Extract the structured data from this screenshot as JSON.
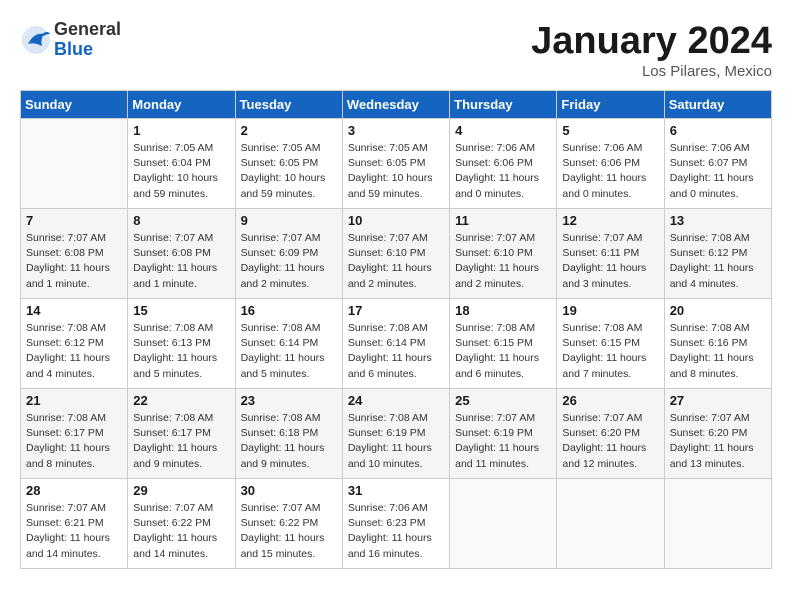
{
  "header": {
    "logo_general": "General",
    "logo_blue": "Blue",
    "month_title": "January 2024",
    "location": "Los Pilares, Mexico"
  },
  "days_of_week": [
    "Sunday",
    "Monday",
    "Tuesday",
    "Wednesday",
    "Thursday",
    "Friday",
    "Saturday"
  ],
  "weeks": [
    [
      {
        "num": "",
        "sunrise": "",
        "sunset": "",
        "daylight": ""
      },
      {
        "num": "1",
        "sunrise": "Sunrise: 7:05 AM",
        "sunset": "Sunset: 6:04 PM",
        "daylight": "Daylight: 10 hours and 59 minutes."
      },
      {
        "num": "2",
        "sunrise": "Sunrise: 7:05 AM",
        "sunset": "Sunset: 6:05 PM",
        "daylight": "Daylight: 10 hours and 59 minutes."
      },
      {
        "num": "3",
        "sunrise": "Sunrise: 7:05 AM",
        "sunset": "Sunset: 6:05 PM",
        "daylight": "Daylight: 10 hours and 59 minutes."
      },
      {
        "num": "4",
        "sunrise": "Sunrise: 7:06 AM",
        "sunset": "Sunset: 6:06 PM",
        "daylight": "Daylight: 11 hours and 0 minutes."
      },
      {
        "num": "5",
        "sunrise": "Sunrise: 7:06 AM",
        "sunset": "Sunset: 6:06 PM",
        "daylight": "Daylight: 11 hours and 0 minutes."
      },
      {
        "num": "6",
        "sunrise": "Sunrise: 7:06 AM",
        "sunset": "Sunset: 6:07 PM",
        "daylight": "Daylight: 11 hours and 0 minutes."
      }
    ],
    [
      {
        "num": "7",
        "sunrise": "Sunrise: 7:07 AM",
        "sunset": "Sunset: 6:08 PM",
        "daylight": "Daylight: 11 hours and 1 minute."
      },
      {
        "num": "8",
        "sunrise": "Sunrise: 7:07 AM",
        "sunset": "Sunset: 6:08 PM",
        "daylight": "Daylight: 11 hours and 1 minute."
      },
      {
        "num": "9",
        "sunrise": "Sunrise: 7:07 AM",
        "sunset": "Sunset: 6:09 PM",
        "daylight": "Daylight: 11 hours and 2 minutes."
      },
      {
        "num": "10",
        "sunrise": "Sunrise: 7:07 AM",
        "sunset": "Sunset: 6:10 PM",
        "daylight": "Daylight: 11 hours and 2 minutes."
      },
      {
        "num": "11",
        "sunrise": "Sunrise: 7:07 AM",
        "sunset": "Sunset: 6:10 PM",
        "daylight": "Daylight: 11 hours and 2 minutes."
      },
      {
        "num": "12",
        "sunrise": "Sunrise: 7:07 AM",
        "sunset": "Sunset: 6:11 PM",
        "daylight": "Daylight: 11 hours and 3 minutes."
      },
      {
        "num": "13",
        "sunrise": "Sunrise: 7:08 AM",
        "sunset": "Sunset: 6:12 PM",
        "daylight": "Daylight: 11 hours and 4 minutes."
      }
    ],
    [
      {
        "num": "14",
        "sunrise": "Sunrise: 7:08 AM",
        "sunset": "Sunset: 6:12 PM",
        "daylight": "Daylight: 11 hours and 4 minutes."
      },
      {
        "num": "15",
        "sunrise": "Sunrise: 7:08 AM",
        "sunset": "Sunset: 6:13 PM",
        "daylight": "Daylight: 11 hours and 5 minutes."
      },
      {
        "num": "16",
        "sunrise": "Sunrise: 7:08 AM",
        "sunset": "Sunset: 6:14 PM",
        "daylight": "Daylight: 11 hours and 5 minutes."
      },
      {
        "num": "17",
        "sunrise": "Sunrise: 7:08 AM",
        "sunset": "Sunset: 6:14 PM",
        "daylight": "Daylight: 11 hours and 6 minutes."
      },
      {
        "num": "18",
        "sunrise": "Sunrise: 7:08 AM",
        "sunset": "Sunset: 6:15 PM",
        "daylight": "Daylight: 11 hours and 6 minutes."
      },
      {
        "num": "19",
        "sunrise": "Sunrise: 7:08 AM",
        "sunset": "Sunset: 6:15 PM",
        "daylight": "Daylight: 11 hours and 7 minutes."
      },
      {
        "num": "20",
        "sunrise": "Sunrise: 7:08 AM",
        "sunset": "Sunset: 6:16 PM",
        "daylight": "Daylight: 11 hours and 8 minutes."
      }
    ],
    [
      {
        "num": "21",
        "sunrise": "Sunrise: 7:08 AM",
        "sunset": "Sunset: 6:17 PM",
        "daylight": "Daylight: 11 hours and 8 minutes."
      },
      {
        "num": "22",
        "sunrise": "Sunrise: 7:08 AM",
        "sunset": "Sunset: 6:17 PM",
        "daylight": "Daylight: 11 hours and 9 minutes."
      },
      {
        "num": "23",
        "sunrise": "Sunrise: 7:08 AM",
        "sunset": "Sunset: 6:18 PM",
        "daylight": "Daylight: 11 hours and 9 minutes."
      },
      {
        "num": "24",
        "sunrise": "Sunrise: 7:08 AM",
        "sunset": "Sunset: 6:19 PM",
        "daylight": "Daylight: 11 hours and 10 minutes."
      },
      {
        "num": "25",
        "sunrise": "Sunrise: 7:07 AM",
        "sunset": "Sunset: 6:19 PM",
        "daylight": "Daylight: 11 hours and 11 minutes."
      },
      {
        "num": "26",
        "sunrise": "Sunrise: 7:07 AM",
        "sunset": "Sunset: 6:20 PM",
        "daylight": "Daylight: 11 hours and 12 minutes."
      },
      {
        "num": "27",
        "sunrise": "Sunrise: 7:07 AM",
        "sunset": "Sunset: 6:20 PM",
        "daylight": "Daylight: 11 hours and 13 minutes."
      }
    ],
    [
      {
        "num": "28",
        "sunrise": "Sunrise: 7:07 AM",
        "sunset": "Sunset: 6:21 PM",
        "daylight": "Daylight: 11 hours and 14 minutes."
      },
      {
        "num": "29",
        "sunrise": "Sunrise: 7:07 AM",
        "sunset": "Sunset: 6:22 PM",
        "daylight": "Daylight: 11 hours and 14 minutes."
      },
      {
        "num": "30",
        "sunrise": "Sunrise: 7:07 AM",
        "sunset": "Sunset: 6:22 PM",
        "daylight": "Daylight: 11 hours and 15 minutes."
      },
      {
        "num": "31",
        "sunrise": "Sunrise: 7:06 AM",
        "sunset": "Sunset: 6:23 PM",
        "daylight": "Daylight: 11 hours and 16 minutes."
      },
      {
        "num": "",
        "sunrise": "",
        "sunset": "",
        "daylight": ""
      },
      {
        "num": "",
        "sunrise": "",
        "sunset": "",
        "daylight": ""
      },
      {
        "num": "",
        "sunrise": "",
        "sunset": "",
        "daylight": ""
      }
    ]
  ]
}
